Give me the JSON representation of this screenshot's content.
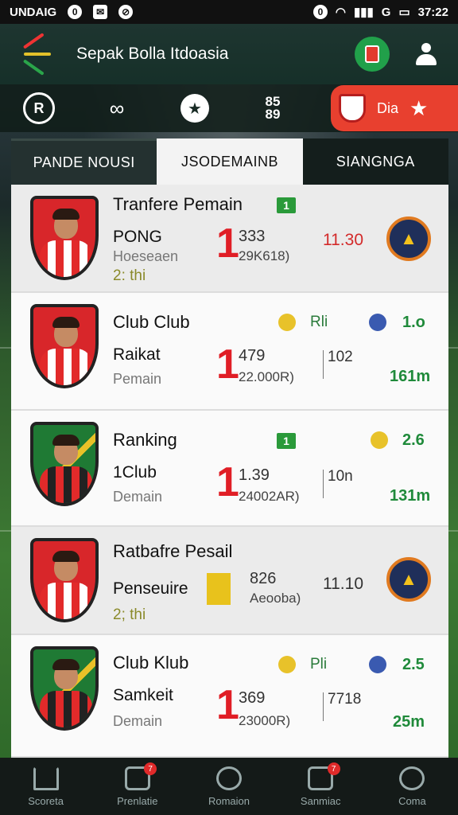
{
  "status_bar": {
    "carrier": "UNDAIG",
    "signal": "G",
    "time": "37:22"
  },
  "app_bar": {
    "title": "Sepak Bolla Itdoasia"
  },
  "icon_bar": {
    "score_top": "85",
    "score_bottom": "89",
    "live_label": "Dia",
    "live_star": "★"
  },
  "tabs": [
    "PANDE NOUSI",
    "JSODEMAINB",
    "SIANGNGA"
  ],
  "cards": [
    {
      "title": "Tranfere Pemain",
      "sub": "PONG",
      "meta": "Hoeseaen",
      "date": "2: thi",
      "flag": "1",
      "big": "1",
      "stat_a": "333",
      "stat_b": "29K618)",
      "ratio": "11.30"
    },
    {
      "title": "Club Club",
      "sub": "Raikat",
      "meta": "Pemain",
      "big": "1",
      "stat_a": "479",
      "stat_b": "22.000R)",
      "side": "102",
      "top_mid": "Rli",
      "top_right": "1.o",
      "right": "161m"
    },
    {
      "title": "Ranking",
      "sub": "1Club",
      "meta": "Demain",
      "flag": "1",
      "big": "1",
      "stat_a": "1.39",
      "stat_b": "24002AR)",
      "side": "10n",
      "top_right": "2.6",
      "right": "131m"
    },
    {
      "title": "Ratbafre Pesail",
      "sub": "Penseuire",
      "date": "2; thi",
      "stat_a": "826",
      "stat_b": "Aeooba)",
      "ratio": "11.10"
    },
    {
      "title": "Club Klub",
      "sub": "Samkeit",
      "meta": "Demain",
      "big": "1",
      "stat_a": "369",
      "stat_b": "23000R)",
      "side": "7718",
      "top_mid": "Pli",
      "top_right": "2.5",
      "right": "25m"
    }
  ],
  "bottom_nav": [
    {
      "label": "Scoreta"
    },
    {
      "label": "Prenlatie",
      "badge": "7"
    },
    {
      "label": "Romaion"
    },
    {
      "label": "Sanmiac",
      "badge": "7"
    },
    {
      "label": "Coma"
    }
  ]
}
